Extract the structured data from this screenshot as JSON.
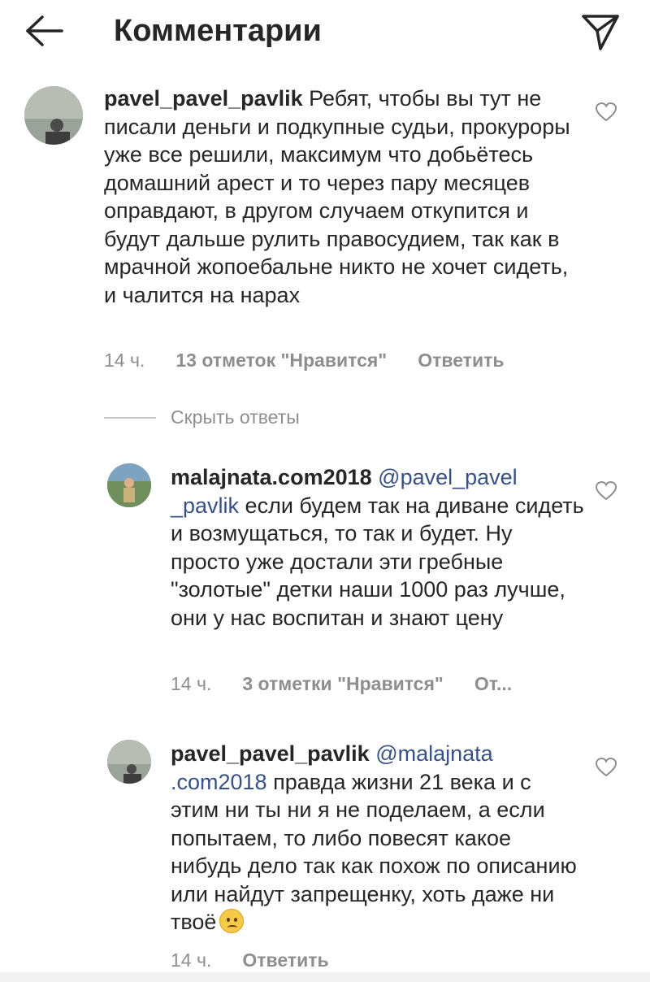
{
  "header": {
    "title": "Комментарии",
    "back_icon": "arrow-left-icon",
    "send_icon": "paper-plane-icon"
  },
  "comments": [
    {
      "username": "pavel_pavel_pavlik",
      "text": " Ребят, чтобы вы тут не писали деньги и подкупные судьи, прокуроры уже все решили, максимум что добьётесь домашний арест и то через пару месяцев оправдают, в другом случаем откупится и будут дальше рулить правосудием, так как в мрачной жопоебальне никто не хочет сидеть, и чалится на нарах",
      "time": "14 ч.",
      "likes": "13 отметок \"Нравится\"",
      "reply": "Ответить"
    }
  ],
  "hide_replies": "Скрыть ответы",
  "replies": [
    {
      "username": "malajnata.com2018",
      "mention": "@pavel_pavel _pavlik",
      "text": " если будем так на диване сидеть и возмущаться, то так и будет. Ну просто уже достали эти гребные \"золотые\" детки наши 1000 раз лучше, они у нас воспитан и знают цену",
      "time": "14 ч.",
      "likes": "3 отметки \"Нравится\"",
      "reply": "От..."
    },
    {
      "username": "pavel_pavel_pavlik",
      "mention": "@malajnata .com2018",
      "text": " правда жизни 21 века и с этим ни ты ни я не поделаем, а если попытаем, то либо повесят какое нибудь дело так как похож по описанию или найдут запрещенку, хоть даже ни твоё",
      "emoji": "slightly-frowning-face-emoji",
      "time": "14 ч.",
      "reply": "Ответить"
    }
  ],
  "colors": {
    "text": "#262626",
    "secondary": "#8e8e8e",
    "mention": "#385185",
    "background": "#ffffff"
  }
}
